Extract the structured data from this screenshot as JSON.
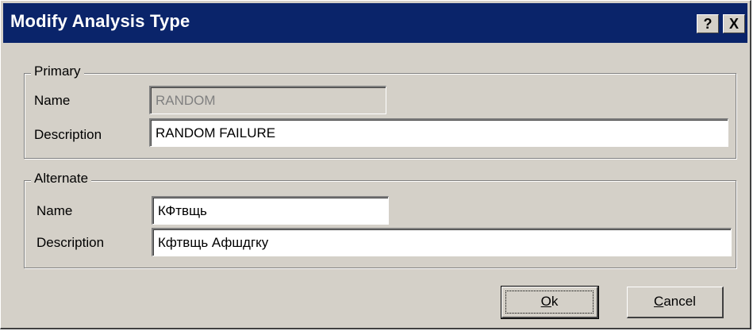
{
  "window": {
    "title": "Modify Analysis Type",
    "help_button": "?",
    "close_button": "X"
  },
  "primary": {
    "legend": "Primary",
    "name_label": "Name",
    "name_value": "RANDOM",
    "description_label": "Description",
    "description_value": "RANDOM FAILURE"
  },
  "alternate": {
    "legend": "Alternate",
    "name_label": "Name",
    "name_value": "КФтвщь",
    "description_label": "Description",
    "description_value": "Кфтвщь Афшдгку"
  },
  "buttons": {
    "ok_accel": "O",
    "ok_rest": "k",
    "cancel_accel": "C",
    "cancel_rest": "ancel"
  }
}
